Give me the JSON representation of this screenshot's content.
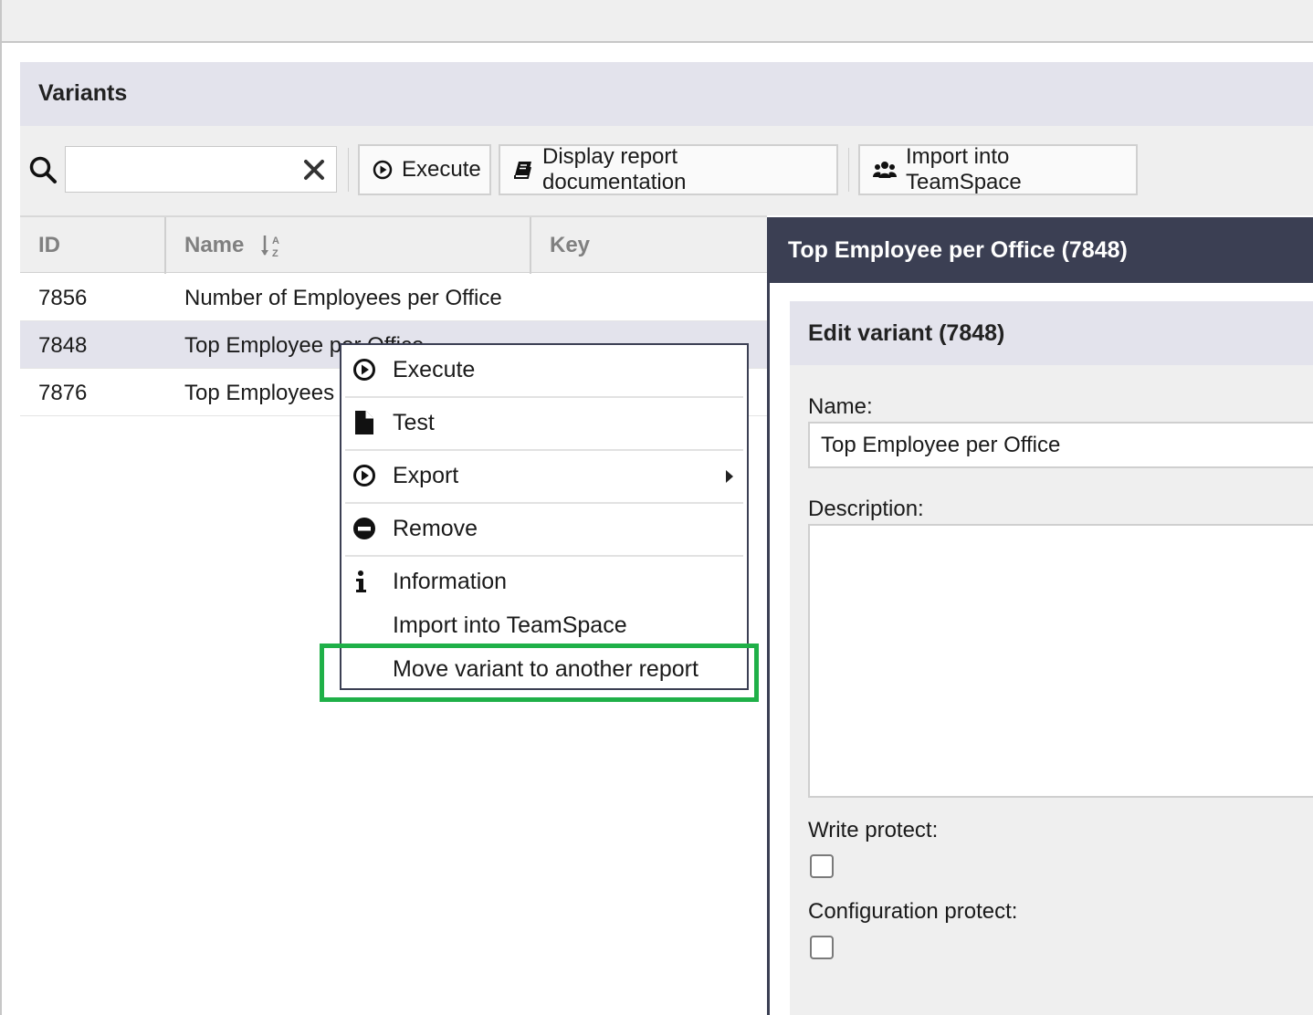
{
  "panel": {
    "title": "Variants"
  },
  "toolbar": {
    "search_placeholder": "",
    "execute_label": "Execute",
    "display_doc_label": "Display report documentation",
    "import_label": "Import into TeamSpace"
  },
  "grid": {
    "columns": {
      "id": "ID",
      "name": "Name",
      "key": "Key"
    },
    "sort": {
      "column": "name",
      "direction": "ascending"
    },
    "rows": [
      {
        "id": "7856",
        "name": "Number of Employees per Office",
        "key": "",
        "selected": false
      },
      {
        "id": "7848",
        "name": "Top Employee per Office",
        "key": "",
        "selected": true
      },
      {
        "id": "7876",
        "name": "Top Employees",
        "key": "",
        "selected": false
      }
    ]
  },
  "context_menu": {
    "items": [
      {
        "label": "Execute",
        "icon": "play-circle-icon"
      },
      {
        "label": "Test",
        "icon": "file-icon"
      },
      {
        "label": "Export",
        "icon": "play-circle-icon",
        "has_submenu": true
      },
      {
        "label": "Remove",
        "icon": "minus-circle-icon"
      },
      {
        "label": "Information",
        "icon": "info-icon"
      },
      {
        "label": "Import into TeamSpace",
        "icon": ""
      },
      {
        "label": "Move variant to another report",
        "icon": "",
        "highlighted": true
      }
    ]
  },
  "detail": {
    "title": "Top Employee per Office (7848)",
    "form_title": "Edit variant (7848)",
    "name_label": "Name:",
    "name_value": "Top Employee per Office",
    "description_label": "Description:",
    "description_value": "",
    "write_protect_label": "Write protect:",
    "write_protect_checked": false,
    "config_protect_label": "Configuration protect:",
    "config_protect_checked": false
  },
  "colors": {
    "header_bg": "#e3e3ec",
    "toolbar_bg": "#efefef",
    "detail_title_bg": "#3b3f53",
    "highlight": "#1fb048"
  }
}
